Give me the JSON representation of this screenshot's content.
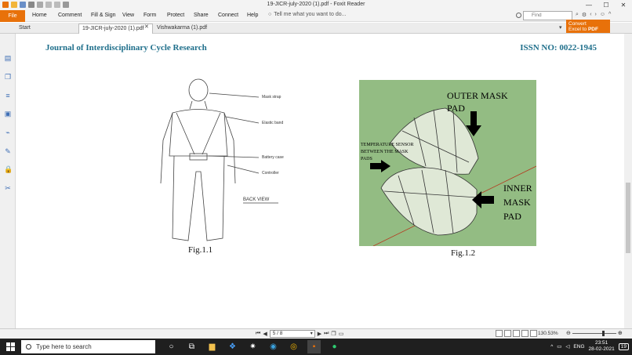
{
  "window": {
    "title": "19-JICR-july-2020 (1).pdf - Foxit Reader",
    "min_glyph": "—",
    "max_glyph": "☐",
    "close_glyph": "✕"
  },
  "menu": {
    "file": "File",
    "items": [
      "Home",
      "Comment",
      "Fill & Sign",
      "View",
      "Form",
      "Protect",
      "Share",
      "Connect",
      "Help"
    ],
    "tell_me": "Tell me what you want to do...",
    "find_placeholder": "Find"
  },
  "tabs": [
    {
      "label": "Start",
      "active": false
    },
    {
      "label": "19-JICR-july-2020 (1).pdf",
      "active": true
    },
    {
      "label": "Vishwakarma (1).pdf",
      "active": false
    }
  ],
  "convert": {
    "line1": "Convert",
    "line2": "Excel to",
    "pdf": "PDF"
  },
  "document": {
    "journal": "Journal of Interdisciplinary Cycle Research",
    "issn": "ISSN NO: 0022-1945",
    "fig1_caption": "Fig.1.1",
    "fig2_caption": "Fig.1.2",
    "fig1_labels": [
      "Mask strap",
      "Elastic band",
      "Battery case",
      "Controller",
      "BACK VIEW"
    ],
    "fig2_labels": {
      "outer1": "OUTER MASK",
      "outer2": "PAD",
      "temp1": "TEMPERATURE SENSOR",
      "temp2": "BETWEEN THE MASK",
      "temp3": "PADS",
      "inner1": "INNER",
      "inner2": "MASK",
      "inner3": "PAD"
    }
  },
  "status": {
    "page": "5 / 8",
    "zoom": "130.53%"
  },
  "taskbar": {
    "search_placeholder": "Type here to search",
    "language": "ENG",
    "time": "23:51",
    "date": "28-02-2021",
    "notif_count": "19"
  },
  "colors": {
    "accent": "#e8710a",
    "journal": "#1f6f8b",
    "figure_bg": "#93bc83"
  }
}
